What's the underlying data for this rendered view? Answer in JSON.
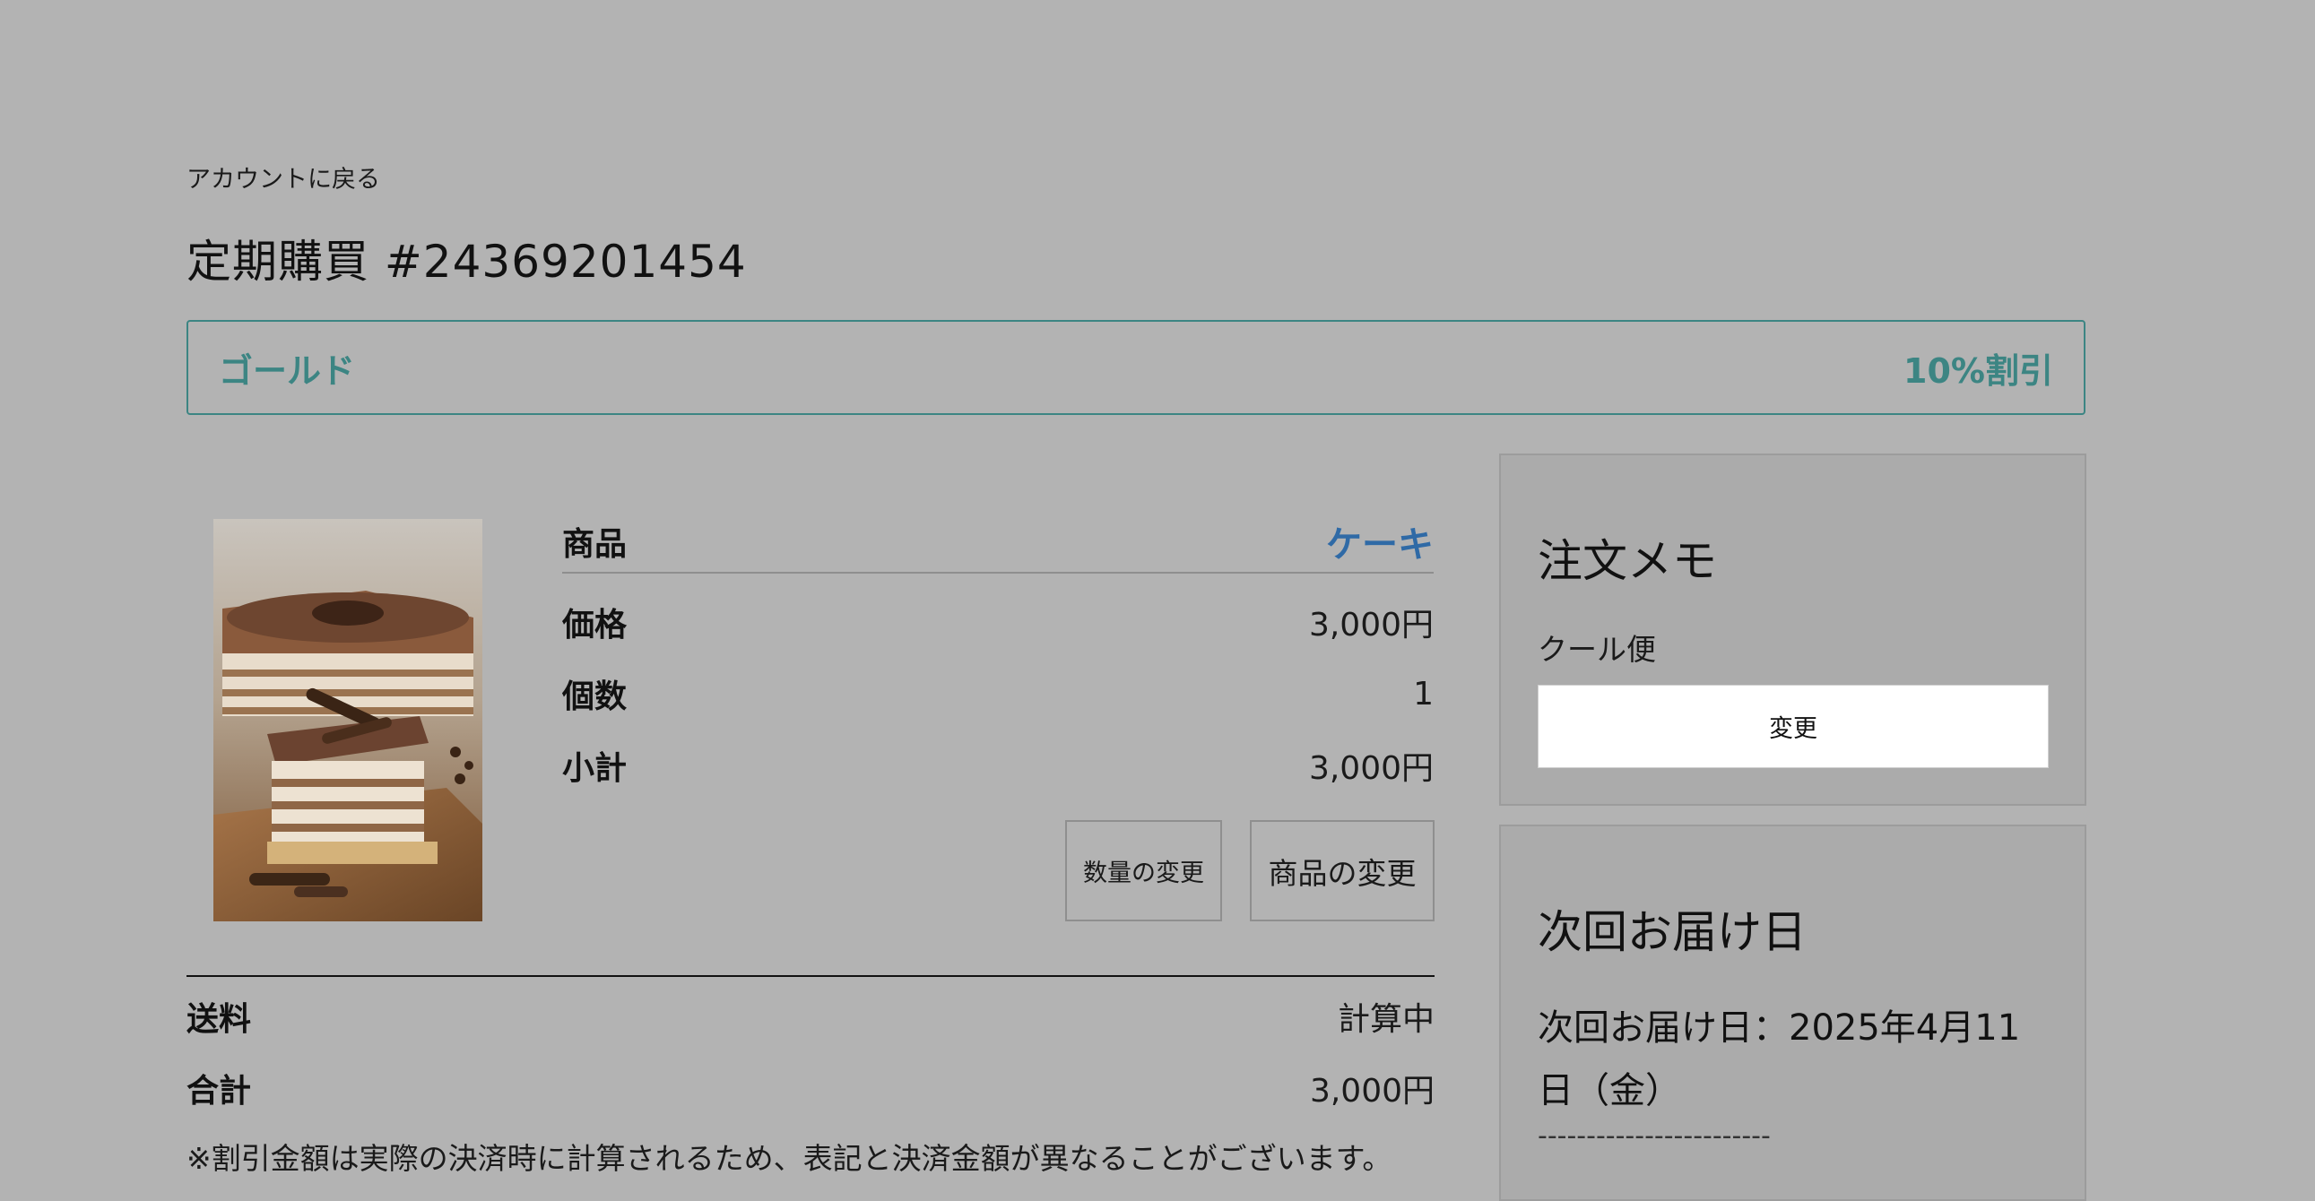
{
  "back_link": "アカウントに戻る",
  "page_title": "定期購買 #24369201454",
  "tier": {
    "name": "ゴールド",
    "discount": "10%割引",
    "color": "#3c8583"
  },
  "product": {
    "image_icon": "cake-photo",
    "rows": {
      "product_label": "商品",
      "product_value": "ケーキ",
      "price_label": "価格",
      "price_value": "3,000円",
      "qty_label": "個数",
      "qty_value": "1",
      "subtotal_label": "小計",
      "subtotal_value": "3,000円"
    },
    "buttons": {
      "change_qty": "数量の変更",
      "change_product": "商品の変更"
    }
  },
  "summary": {
    "shipping_label": "送料",
    "shipping_value": "計算中",
    "total_label": "合計",
    "total_value": "3,000円",
    "note": "※割引金額は実際の決済時に計算されるため、表記と決済金額が異なることがございます。"
  },
  "order_memo": {
    "title": "注文メモ",
    "text": "クール便",
    "button": "変更"
  },
  "next_delivery": {
    "title": "次回お届け日",
    "text": "次回お届け日：2025年4月11日（金）",
    "separator": "------------------------"
  },
  "colors": {
    "link_blue": "#2f6aa6",
    "background": "#b3b3b3"
  }
}
